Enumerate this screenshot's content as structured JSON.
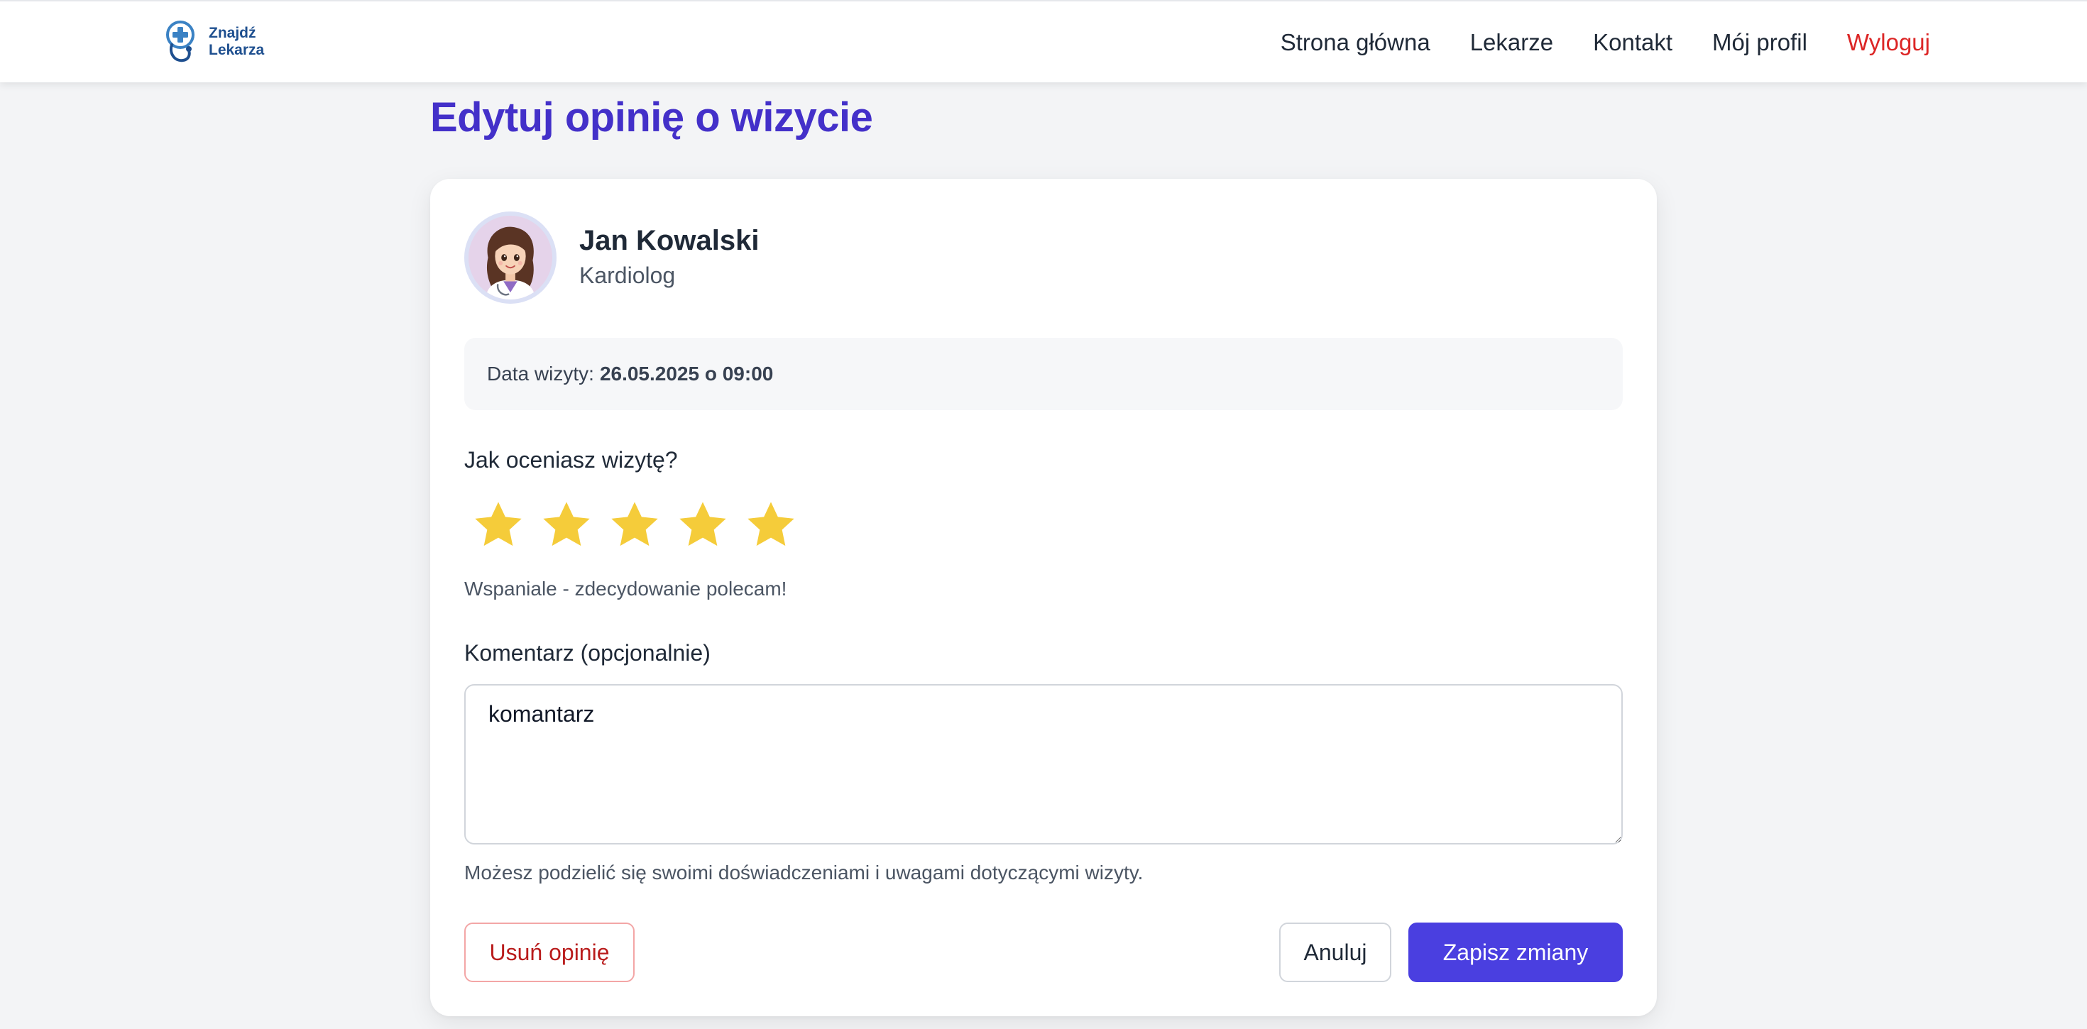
{
  "navbar": {
    "brand": {
      "line1": "Znajdź",
      "line2": "Lekarza",
      "icon": "stethoscope-plus-logo-icon"
    },
    "links": [
      {
        "label": "Strona główna"
      },
      {
        "label": "Lekarze"
      },
      {
        "label": "Kontakt"
      },
      {
        "label": "Mój profil"
      },
      {
        "label": "Wyloguj"
      }
    ]
  },
  "page": {
    "title": "Edytuj opinię o wizycie"
  },
  "doctor": {
    "name": "Jan Kowalski",
    "specialization": "Kardiolog",
    "avatar_icon": "doctor-avatar-illustration"
  },
  "visit": {
    "label": "Data wizyty:",
    "value": "26.05.2025 o 09:00"
  },
  "rating": {
    "question": "Jak oceniasz wizytę?",
    "value": 5,
    "max": 5,
    "description": "Wspaniale - zdecydowanie polecam!",
    "star_color": "#f5cc3a"
  },
  "comment": {
    "label": "Komentarz (opcjonalnie)",
    "value": "komantarz",
    "help": "Możesz podzielić się swoimi doświadczeniami i uwagami dotyczącymi wizyty."
  },
  "actions": {
    "delete_label": "Usuń opinię",
    "cancel_label": "Anuluj",
    "save_label": "Zapisz zmiany"
  },
  "colors": {
    "accent": "#4330c9",
    "primary_button": "#4a3fe0",
    "danger": "#dc2626"
  }
}
